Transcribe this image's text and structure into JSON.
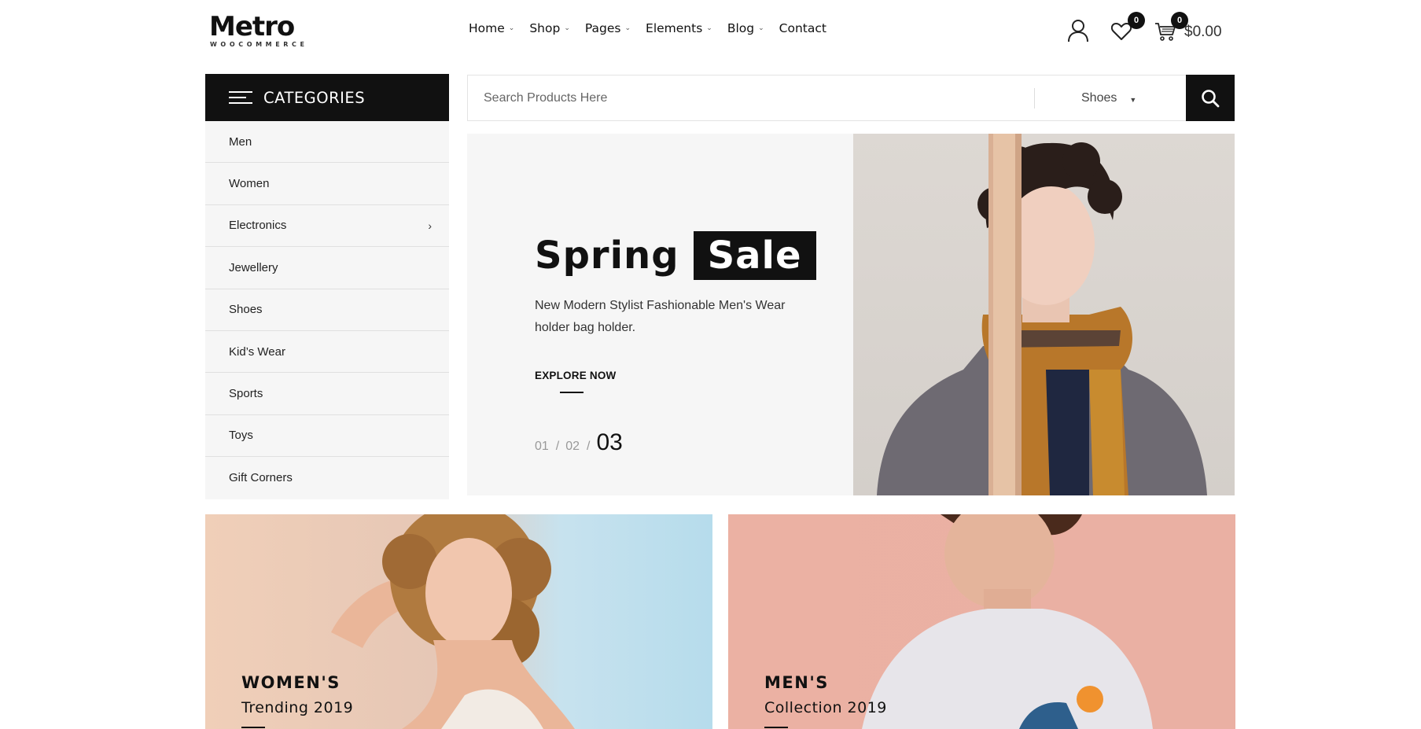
{
  "logo": {
    "main": "Metro",
    "sub": "WOOCOMMERCE"
  },
  "nav": [
    {
      "label": "Home",
      "has_dropdown": true
    },
    {
      "label": "Shop",
      "has_dropdown": true
    },
    {
      "label": "Pages",
      "has_dropdown": true
    },
    {
      "label": "Elements",
      "has_dropdown": true
    },
    {
      "label": "Blog",
      "has_dropdown": true
    },
    {
      "label": "Contact",
      "has_dropdown": false
    }
  ],
  "header": {
    "account_icon": "user-icon",
    "wishlist_icon": "heart-icon",
    "wishlist_count": "0",
    "cart_icon": "cart-icon",
    "cart_count": "0",
    "cart_total": "$0.00"
  },
  "categories": {
    "title": "CATEGORIES",
    "items": [
      {
        "label": "Men",
        "has_submenu": false
      },
      {
        "label": "Women",
        "has_submenu": false
      },
      {
        "label": "Electronics",
        "has_submenu": true
      },
      {
        "label": "Jewellery",
        "has_submenu": false
      },
      {
        "label": "Shoes",
        "has_submenu": false
      },
      {
        "label": "Kid’s Wear",
        "has_submenu": false
      },
      {
        "label": "Sports",
        "has_submenu": false
      },
      {
        "label": "Toys",
        "has_submenu": false
      },
      {
        "label": "Gift Corners",
        "has_submenu": false
      }
    ]
  },
  "search": {
    "placeholder": "Search Products Here",
    "category_selected": "Shoes",
    "button_icon": "search-icon"
  },
  "hero": {
    "title_plain": "Spring",
    "title_highlight": "Sale",
    "description": "New Modern Stylist Fashionable Men's Wear holder bag holder.",
    "cta": "EXPLORE NOW",
    "pager": {
      "slide1": "01",
      "slide2": "02",
      "active": "03",
      "separator": "/"
    }
  },
  "promos": [
    {
      "title": "WOMEN'S",
      "subtitle": "Trending 2019"
    },
    {
      "title": "MEN'S",
      "subtitle": "Collection 2019"
    }
  ],
  "colors": {
    "primary": "#111111",
    "panel": "#f6f6f6",
    "accent_pink": "#ebb1a3",
    "accent_blue": "#b6dcec"
  }
}
